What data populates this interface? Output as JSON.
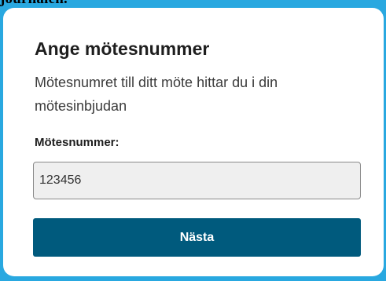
{
  "page": {
    "top_fragment": "journalen."
  },
  "card": {
    "title": "Ange mötesnummer",
    "subtitle": "Mötesnumret till ditt möte hittar du i din mötesinbjudan",
    "field_label": "Mötesnummer:",
    "field_value": "123456",
    "next_button_label": "Nästa"
  },
  "colors": {
    "frame_background": "#29a8e0",
    "card_background": "#ffffff",
    "button_background": "#005a7d",
    "input_background": "#efefef"
  }
}
